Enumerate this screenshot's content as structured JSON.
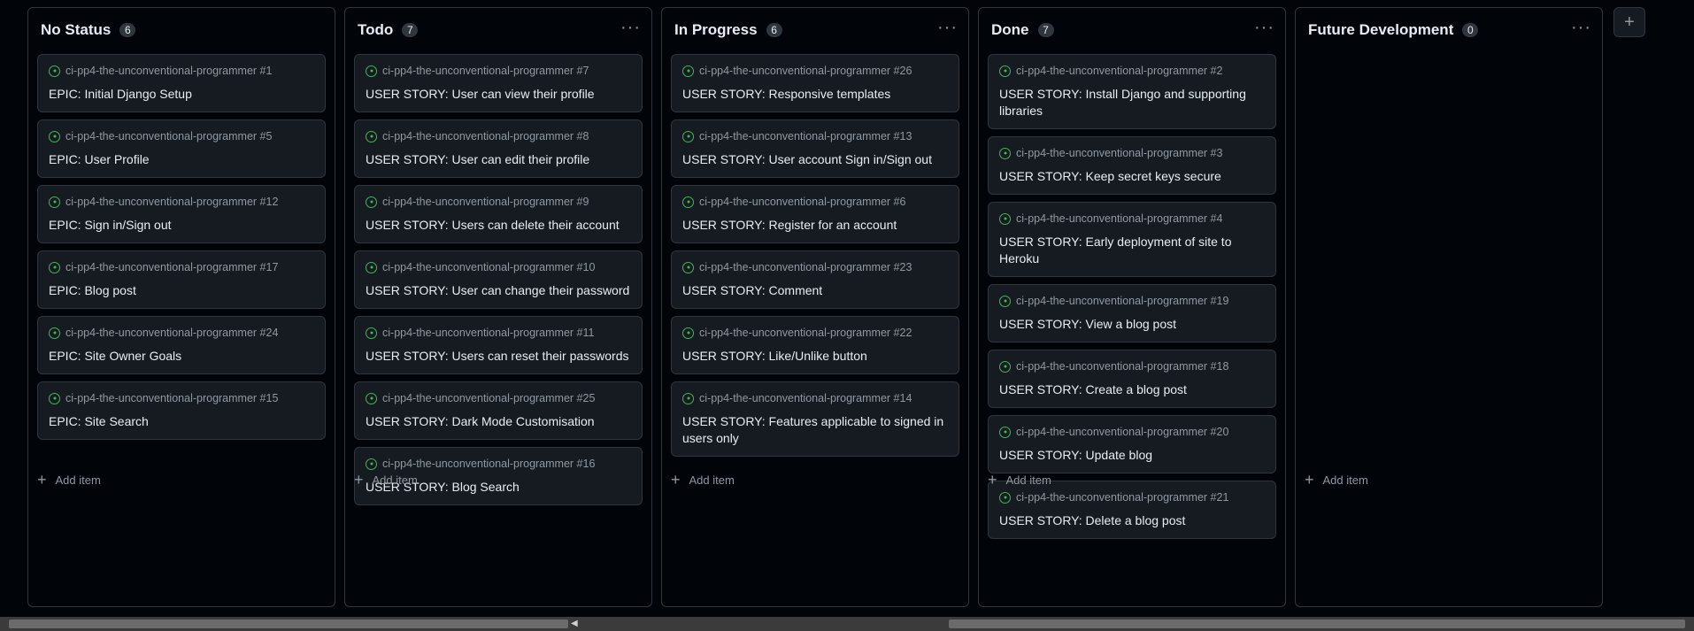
{
  "columns": [
    {
      "title": "No Status",
      "count": "6",
      "show_menu": false,
      "add_item_label": "Add item",
      "cards": [
        {
          "repo": "ci-pp4-the-unconventional-programmer #1",
          "title": "EPIC: Initial Django Setup"
        },
        {
          "repo": "ci-pp4-the-unconventional-programmer #5",
          "title": "EPIC: User Profile"
        },
        {
          "repo": "ci-pp4-the-unconventional-programmer #12",
          "title": "EPIC: Sign in/Sign out"
        },
        {
          "repo": "ci-pp4-the-unconventional-programmer #17",
          "title": "EPIC: Blog post"
        },
        {
          "repo": "ci-pp4-the-unconventional-programmer #24",
          "title": "EPIC: Site Owner Goals"
        },
        {
          "repo": "ci-pp4-the-unconventional-programmer #15",
          "title": "EPIC: Site Search"
        }
      ]
    },
    {
      "title": "Todo",
      "count": "7",
      "show_menu": true,
      "add_item_label": "Add item",
      "cards": [
        {
          "repo": "ci-pp4-the-unconventional-programmer #7",
          "title": "USER STORY: User can view their profile"
        },
        {
          "repo": "ci-pp4-the-unconventional-programmer #8",
          "title": "USER STORY: User can edit their profile"
        },
        {
          "repo": "ci-pp4-the-unconventional-programmer #9",
          "title": "USER STORY: Users can delete their account"
        },
        {
          "repo": "ci-pp4-the-unconventional-programmer #10",
          "title": "USER STORY: User can change their password"
        },
        {
          "repo": "ci-pp4-the-unconventional-programmer #11",
          "title": "USER STORY: Users can reset their passwords"
        },
        {
          "repo": "ci-pp4-the-unconventional-programmer #25",
          "title": "USER STORY: Dark Mode Customisation"
        },
        {
          "repo": "ci-pp4-the-unconventional-programmer #16",
          "title": "USER STORY: Blog Search"
        }
      ]
    },
    {
      "title": "In Progress",
      "count": "6",
      "show_menu": true,
      "add_item_label": "Add item",
      "cards": [
        {
          "repo": "ci-pp4-the-unconventional-programmer #26",
          "title": "USER STORY: Responsive templates"
        },
        {
          "repo": "ci-pp4-the-unconventional-programmer #13",
          "title": "USER STORY: User account Sign in/Sign out"
        },
        {
          "repo": "ci-pp4-the-unconventional-programmer #6",
          "title": "USER STORY: Register for an account"
        },
        {
          "repo": "ci-pp4-the-unconventional-programmer #23",
          "title": "USER STORY: Comment"
        },
        {
          "repo": "ci-pp4-the-unconventional-programmer #22",
          "title": "USER STORY: Like/Unlike button"
        },
        {
          "repo": "ci-pp4-the-unconventional-programmer #14",
          "title": "USER STORY: Features applicable to signed in users only"
        }
      ]
    },
    {
      "title": "Done",
      "count": "7",
      "show_menu": true,
      "add_item_label": "Add item",
      "cards": [
        {
          "repo": "ci-pp4-the-unconventional-programmer #2",
          "title": "USER STORY: Install Django and supporting libraries"
        },
        {
          "repo": "ci-pp4-the-unconventional-programmer #3",
          "title": "USER STORY: Keep secret keys secure"
        },
        {
          "repo": "ci-pp4-the-unconventional-programmer #4",
          "title": "USER STORY: Early deployment of site to Heroku"
        },
        {
          "repo": "ci-pp4-the-unconventional-programmer #19",
          "title": "USER STORY: View a blog post"
        },
        {
          "repo": "ci-pp4-the-unconventional-programmer #18",
          "title": "USER STORY: Create a blog post"
        },
        {
          "repo": "ci-pp4-the-unconventional-programmer #20",
          "title": "USER STORY: Update blog"
        },
        {
          "repo": "ci-pp4-the-unconventional-programmer #21",
          "title": "USER STORY: Delete a blog post"
        }
      ]
    },
    {
      "title": "Future Development",
      "count": "0",
      "show_menu": true,
      "add_item_label": "Add item",
      "cards": []
    }
  ],
  "menu_glyph": "···",
  "add_column_glyph": "+",
  "add_item_glyph": "+",
  "colors": {
    "background": "#010409",
    "card": "#161b22",
    "border": "#30363d",
    "open_issue_icon": "#3fb950",
    "muted_text": "#9198a1",
    "text": "#e6edf3"
  },
  "icons": {
    "card": "issue-opened-icon",
    "menu": "kebab-horizontal-icon",
    "add": "plus-icon"
  }
}
